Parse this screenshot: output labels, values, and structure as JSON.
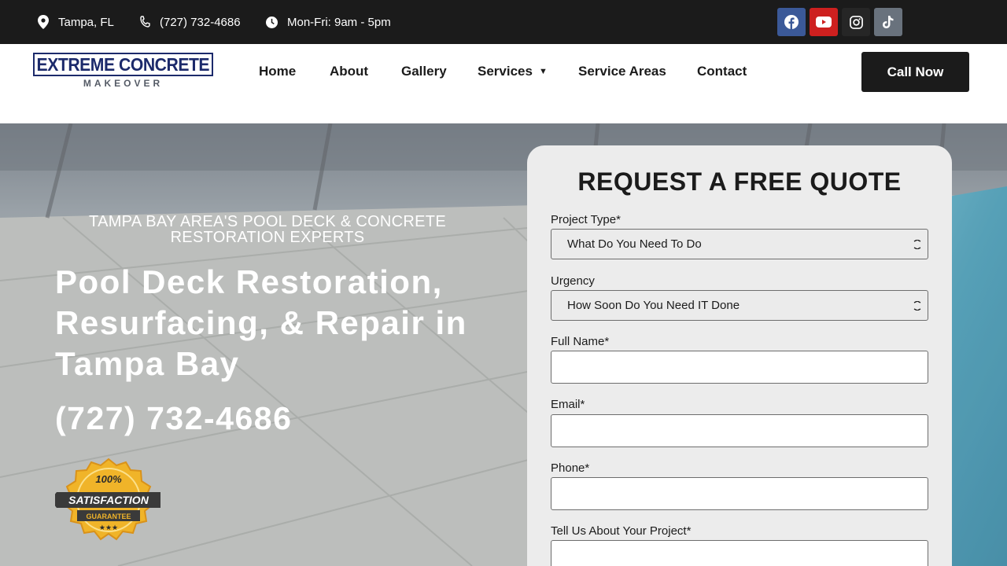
{
  "topbar": {
    "location": "Tampa, FL",
    "phone": "(727) 732-4686",
    "hours": "Mon-Fri: 9am - 5pm",
    "social": [
      "facebook-icon",
      "youtube-icon",
      "instagram-icon",
      "tiktok-icon"
    ]
  },
  "brand": {
    "logo_main": "EXTREME CONCRETE",
    "logo_sub": "MAKEOVER"
  },
  "nav": {
    "home": "Home",
    "about": "About",
    "gallery": "Gallery",
    "services": "Services",
    "service_areas": "Service Areas",
    "contact": "Contact"
  },
  "cta": {
    "call_now": "Call Now"
  },
  "hero": {
    "tagline": "TAMPA BAY AREA'S POOL DECK & CONCRETE RESTORATION EXPERTS",
    "headline": "Pool Deck Restoration, Resurfacing, & Repair in Tampa Bay",
    "phone": "(727) 732-4686",
    "badge": {
      "top": "100%",
      "middle": "SATISFACTION",
      "bottom": "GUARANTEE"
    }
  },
  "form": {
    "title": "REQUEST A FREE QUOTE",
    "project_type_label": "Project Type*",
    "project_type_value": "What Do You Need To Do",
    "urgency_label": "Urgency",
    "urgency_value": "How Soon Do You Need IT Done",
    "full_name_label": "Full Name*",
    "email_label": "Email*",
    "phone_label": "Phone*",
    "project_label": "Tell Us About Your Project*"
  },
  "colors": {
    "dark": "#1b1b1b",
    "logo_navy": "#1c2a6b",
    "facebook": "#3b5998",
    "youtube": "#cd201f",
    "instagram": "#262626",
    "tiktok": "#69727d",
    "form_bg": "#ececec",
    "badge_gold": "#f0b429"
  }
}
